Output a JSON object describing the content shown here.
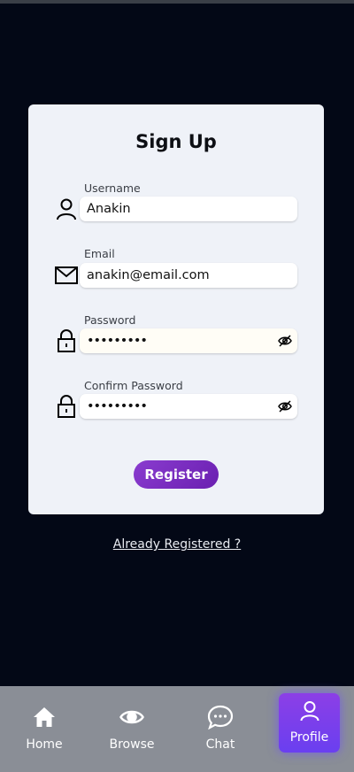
{
  "form": {
    "title": "Sign Up",
    "fields": [
      {
        "label": "Username",
        "value": "Anakin",
        "icon": "user-icon"
      },
      {
        "label": "Email",
        "value": "anakin@email.com",
        "icon": "mail-icon"
      },
      {
        "label": "Password",
        "value": "•••••••••",
        "icon": "lock-icon",
        "toggle_icon": "eye-off-icon"
      },
      {
        "label": "Confirm Password",
        "value": "•••••••••",
        "icon": "lock-icon",
        "toggle_icon": "eye-off-icon"
      }
    ],
    "register_label": "Register",
    "login_link": "Already Registered ?"
  },
  "nav": {
    "items": [
      {
        "label": "Home",
        "icon": "home-icon"
      },
      {
        "label": "Browse",
        "icon": "eye-icon"
      },
      {
        "label": "Chat",
        "icon": "chat-icon"
      },
      {
        "label": "Profile",
        "icon": "user-icon",
        "active": true
      }
    ]
  },
  "colors": {
    "background": "#030816",
    "card": "#eff2f8",
    "accent": "#7b2fc4",
    "nav_bar": "#8a8e96",
    "nav_active": "#7a3fe8"
  }
}
